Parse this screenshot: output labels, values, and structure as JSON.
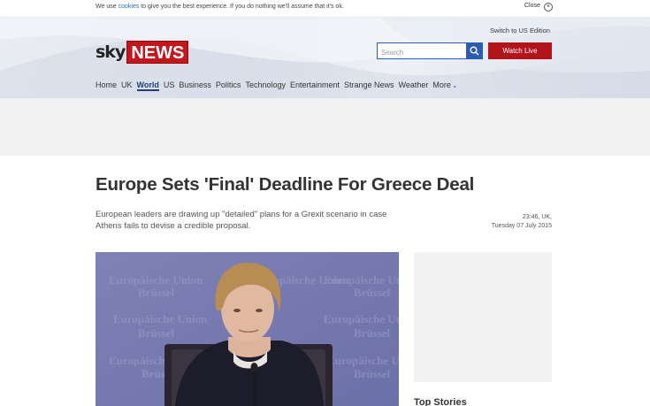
{
  "cookie_bar": {
    "text_before": "We use ",
    "link": "cookies",
    "text_after": " to give you the best experience. If you do nothing we'll assume that it's ok.",
    "close_label": "Close",
    "close_icon": "close-circle-icon"
  },
  "header": {
    "switch_edition": "Switch to US Edition",
    "logo_sky": "sky",
    "logo_news": "NEWS",
    "search_placeholder": "Search",
    "watch_live": "Watch Live",
    "brand_red": "#c4161c",
    "accent_blue": "#2a5db0"
  },
  "nav": {
    "items": [
      "Home",
      "UK",
      "World",
      "US",
      "Business",
      "Politics",
      "Technology",
      "Entertainment",
      "Strange News",
      "Weather",
      "More"
    ],
    "active": "World"
  },
  "article": {
    "headline": "Europe Sets 'Final' Deadline For Greece Deal",
    "standfirst": "European leaders are drawing up \"detailed\" plans for a Grexit scenario in case Athens fails to devise a credible proposal.",
    "time": "23:46, UK,",
    "date": "Tuesday 07 July 2015",
    "image_backdrop_text": [
      "Europäische Union",
      "Brüssel"
    ]
  },
  "sidebar": {
    "top_stories": "Top Stories"
  }
}
